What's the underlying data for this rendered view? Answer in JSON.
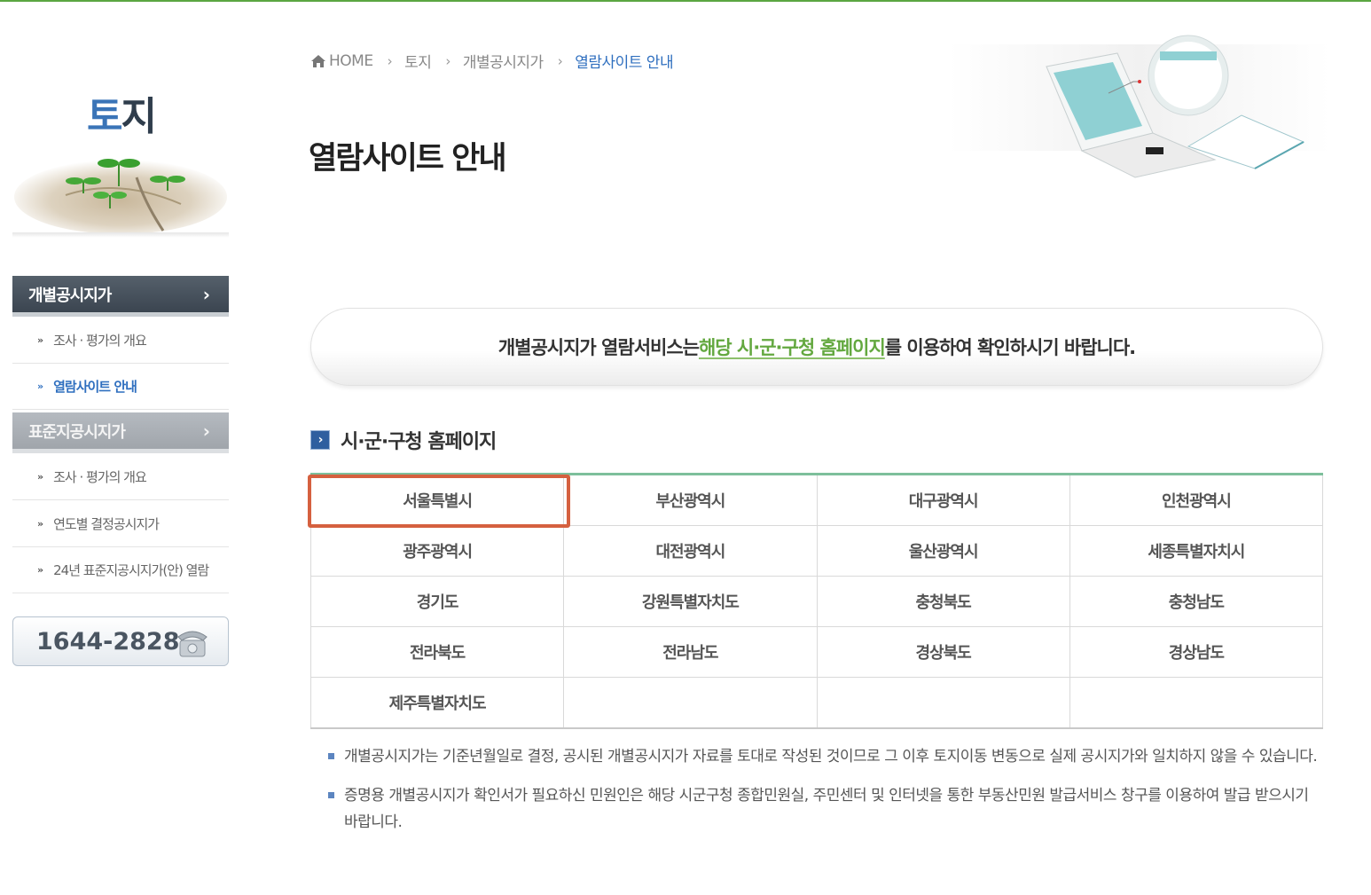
{
  "sidebar": {
    "title_first": "토",
    "title_rest": "지",
    "menus": [
      {
        "label": "개별공시지가",
        "chevron": "›",
        "items": [
          {
            "label": "조사 · 평가의 개요",
            "active": false
          },
          {
            "label": "열람사이트 안내",
            "active": true
          }
        ]
      },
      {
        "label": "표준지공시지가",
        "chevron": "›",
        "items": [
          {
            "label": "조사 · 평가의 개요",
            "active": false
          },
          {
            "label": "연도별 결정공시지가",
            "active": false
          },
          {
            "label": "24년 표준지공시지가(안) 열람",
            "active": false
          }
        ]
      }
    ],
    "phone": "1644-2828",
    "bullet": "»"
  },
  "breadcrumb": {
    "home": "HOME",
    "separator": "›",
    "items": [
      "토지",
      "개별공시지가",
      "열람사이트 안내"
    ]
  },
  "page_title": "열람사이트 안내",
  "notice": {
    "before": "개별공시지가 열람서비스는 ",
    "highlight": "해당 시·군·구청 홈페이지",
    "after": "를 이용하여 확인하시기 바랍니다."
  },
  "section_title": "시·군·구청 홈페이지",
  "section_icon": "›",
  "regions": [
    [
      "서울특별시",
      "부산광역시",
      "대구광역시",
      "인천광역시"
    ],
    [
      "광주광역시",
      "대전광역시",
      "울산광역시",
      "세종특별자치시"
    ],
    [
      "경기도",
      "강원특별자치도",
      "충청북도",
      "충청남도"
    ],
    [
      "전라북도",
      "전라남도",
      "경상북도",
      "경상남도"
    ],
    [
      "제주특별자치도",
      "",
      "",
      ""
    ]
  ],
  "notes": [
    "개별공시지가는 기준년월일로 결정, 공시된 개별공시지가 자료를 토대로 작성된 것이므로 그 이후 토지이동 변동으로 실제 공시지가와 일치하지 않을 수 있습니다.",
    "증명용 개별공시지가 확인서가 필요하신 민원인은 해당 시군구청 종합민원실, 주민센터 및 인터넷을 통한 부동산민원 발급서비스 창구를 이용하여 발급 받으시기 바랍니다."
  ],
  "colors": {
    "accent_blue": "#2f6fbf",
    "accent_green": "#63a83f",
    "highlight_border": "#d5603f"
  },
  "icons": {
    "home": "home-icon",
    "phone": "telephone-icon",
    "section": "arrow-right-icon"
  }
}
